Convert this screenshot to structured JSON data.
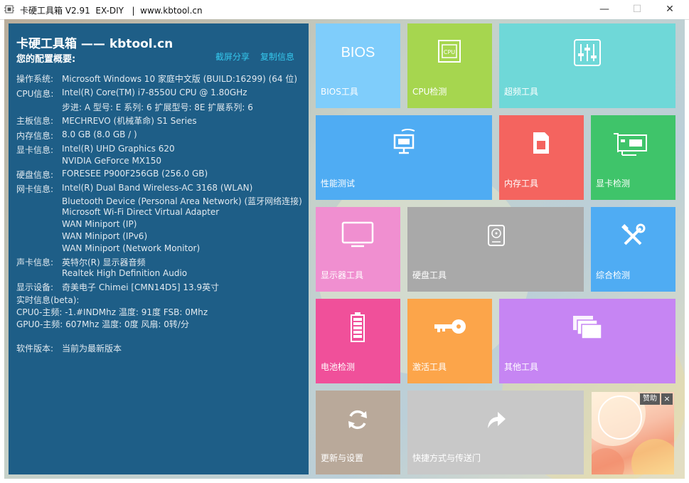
{
  "window": {
    "title": "卡硬工具箱 V2.91  EX-DIY   |  www.kbtool.cn",
    "min_glyph": "—",
    "max_glyph": "☐",
    "close_glyph": "✕"
  },
  "panel": {
    "title": "卡硬工具箱 —— kbtool.cn",
    "subtitle": "您的配置概要:",
    "share_link": "截屏分享",
    "copy_link": "复制信息",
    "rows": [
      {
        "label": "操作系统:",
        "lines": [
          "Microsoft Windows 10 家庭中文版 (BUILD:16299) (64 位)"
        ]
      },
      {
        "label": "CPU信息:",
        "lines": [
          "Intel(R) Core(TM) i7-8550U CPU @ 1.80GHz",
          "步进: A 型号: E 系列: 6 扩展型号: 8E 扩展系列: 6"
        ]
      },
      {
        "label": "主板信息:",
        "lines": [
          "MECHREVO (机械革命) S1 Series"
        ]
      },
      {
        "label": "内存信息:",
        "lines": [
          "8.0 GB (8.0 GB / )"
        ]
      },
      {
        "label": "显卡信息:",
        "lines": [
          "Intel(R) UHD Graphics 620",
          "NVIDIA GeForce MX150"
        ]
      },
      {
        "label": "硬盘信息:",
        "lines": [
          "FORESEE P900F256GB (256.0 GB)"
        ]
      },
      {
        "label": "网卡信息:",
        "lines": [
          "Intel(R) Dual Band Wireless-AC 3168 (WLAN)",
          "Bluetooth Device (Personal Area Network) (蓝牙网络连接)",
          "Microsoft Wi-Fi Direct Virtual Adapter",
          "WAN Miniport (IP)",
          "WAN Miniport (IPv6)",
          "WAN Miniport (Network Monitor)"
        ]
      },
      {
        "label": "声卡信息:",
        "lines": [
          "英特尔(R) 显示器音频",
          "Realtek High Definition Audio"
        ]
      },
      {
        "label": "显示设备:",
        "lines": [
          "奇美电子 Chimei [CMN14D5] 13.9英寸"
        ]
      }
    ],
    "realtime_title": "实时信息(beta):",
    "cpu_realtime": "CPU0-主频: -1.#INDMhz 温度: 91度 FSB: 0Mhz",
    "gpu_realtime": "GPU0-主频: 607Mhz 温度: 0度 风扇: 0转/分",
    "version_label": "软件版本:",
    "version_value": "当前为最新版本"
  },
  "tiles": [
    {
      "label": "BIOS工具",
      "icon": "bios-text-icon",
      "icon_text": "BIOS",
      "color": "#7fcdfb"
    },
    {
      "label": "CPU检测",
      "icon": "cpu-chip-icon",
      "icon_text": "CPU",
      "color": "#a6d64f"
    },
    {
      "label": "超频工具",
      "icon": "sliders-icon",
      "color": "#6fd8d8"
    },
    {
      "label": "性能测试",
      "icon": "monitor-benchmark-icon",
      "color": "#4facf3"
    },
    {
      "label": "内存工具",
      "icon": "memory-card-icon",
      "color": "#f4645f"
    },
    {
      "label": "显卡检测",
      "icon": "graphics-card-icon",
      "color": "#3fc46a"
    },
    {
      "label": "显示器工具",
      "icon": "display-icon",
      "color": "#f08fd0"
    },
    {
      "label": "硬盘工具",
      "icon": "hard-disk-icon",
      "color": "#a9a9a9"
    },
    {
      "label": "综合检测",
      "icon": "tools-icon",
      "color": "#4facf3"
    },
    {
      "label": "电池检测",
      "icon": "battery-icon",
      "color": "#f0509a"
    },
    {
      "label": "激活工具",
      "icon": "key-icon",
      "color": "#fca54a"
    },
    {
      "label": "其他工具",
      "icon": "windows-stack-icon",
      "color": "#c685f3"
    },
    {
      "label": "更新与设置",
      "icon": "refresh-icon",
      "color": "#b9a99a"
    },
    {
      "label": "快捷方式与传送门",
      "icon": "share-arrow-icon",
      "color": "#c8c8c8"
    }
  ],
  "ad": {
    "badge": "赞助",
    "close": "×"
  }
}
